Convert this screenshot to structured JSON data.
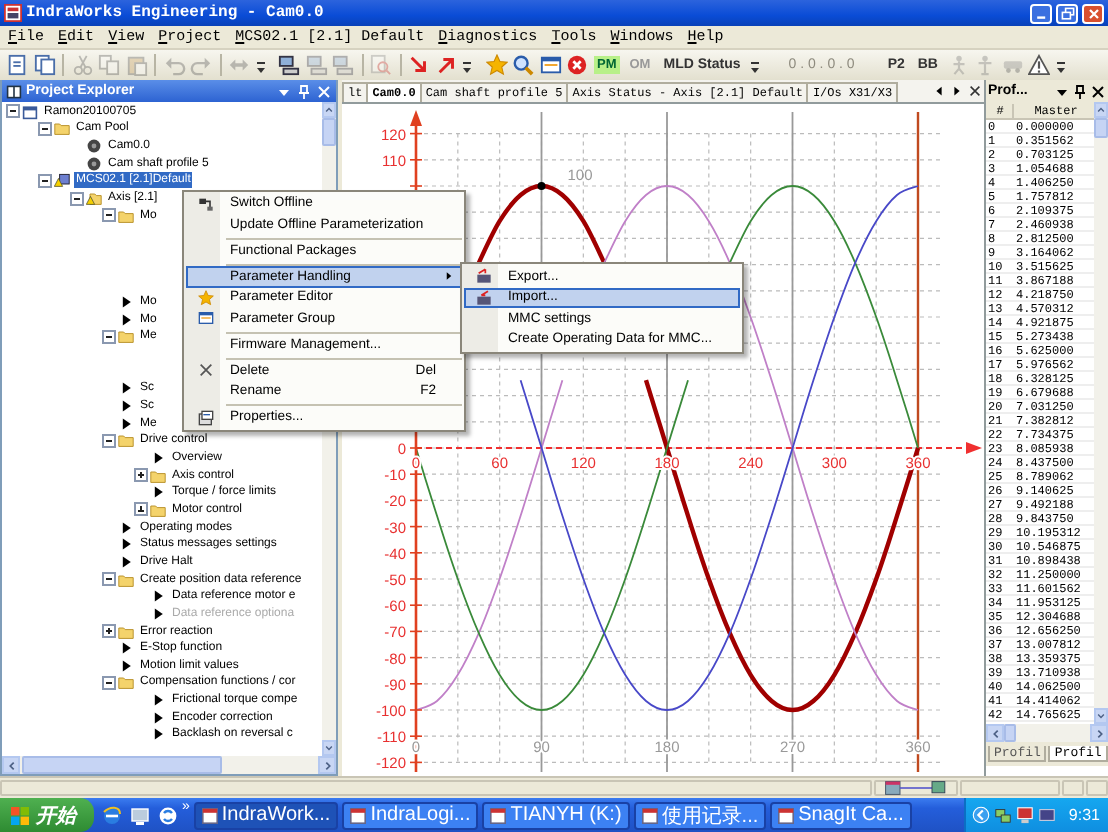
{
  "window": {
    "title": "IndraWorks Engineering - Cam0.0"
  },
  "menu_bar": [
    "File",
    "Edit",
    "View",
    "Project",
    "MCS02.1 [2.1] Default",
    "Diagnostics",
    "Tools",
    "Windows",
    "Help"
  ],
  "toolbar": [
    {
      "kind": "icon",
      "disabled": false
    },
    {
      "kind": "icon",
      "disabled": false
    },
    {
      "kind": "separator"
    },
    {
      "kind": "icon",
      "disabled": true
    },
    {
      "kind": "icon",
      "disabled": true
    },
    {
      "kind": "icon",
      "disabled": true
    },
    {
      "kind": "separator"
    },
    {
      "kind": "icon",
      "disabled": true
    },
    {
      "kind": "icon",
      "disabled": true
    },
    {
      "kind": "separator"
    },
    {
      "kind": "icon",
      "disabled": true
    },
    {
      "kind": "overflow"
    },
    {
      "kind": "icon",
      "disabled": false
    },
    {
      "kind": "icon",
      "disabled": true
    },
    {
      "kind": "icon",
      "disabled": true
    },
    {
      "kind": "separator"
    },
    {
      "kind": "icon",
      "disabled": true
    },
    {
      "kind": "separator"
    },
    {
      "kind": "icon",
      "disabled": false
    },
    {
      "kind": "icon",
      "disabled": false
    },
    {
      "kind": "overflow"
    },
    {
      "kind": "icon",
      "disabled": false
    },
    {
      "kind": "icon",
      "disabled": false
    },
    {
      "kind": "icon",
      "disabled": false
    },
    {
      "kind": "icon",
      "disabled": false
    },
    {
      "kind": "toggle",
      "label": "PM",
      "on": true
    },
    {
      "kind": "toggle",
      "label": "OM",
      "on": false
    },
    {
      "kind": "text",
      "label": "MLD Status",
      "disabled": false
    },
    {
      "kind": "overflow"
    },
    {
      "kind": "text",
      "label": "0 . 0 . 0 . 0",
      "disabled": true
    },
    {
      "kind": "text",
      "label": "P2",
      "disabled": false
    },
    {
      "kind": "text",
      "label": "BB",
      "disabled": false
    },
    {
      "kind": "icon",
      "disabled": true
    },
    {
      "kind": "icon",
      "disabled": true
    },
    {
      "kind": "icon",
      "disabled": true
    },
    {
      "kind": "icon",
      "disabled": false
    },
    {
      "kind": "overflow"
    }
  ],
  "project_explorer": {
    "title": "Project Explorer",
    "tree": [
      {
        "label": "Ramon20100705",
        "kind": "project",
        "expanded": true,
        "selected": false,
        "children": [
          {
            "label": "Cam Pool",
            "kind": "folder",
            "expanded": true,
            "selected": false,
            "children": [
              {
                "label": "Cam0.0",
                "kind": "cam",
                "selected": false
              },
              {
                "label": "Cam shaft profile 5",
                "kind": "cam",
                "selected": false
              }
            ]
          },
          {
            "label": "MCS02.1 [2.1]Default",
            "kind": "device",
            "expanded": true,
            "selected": true,
            "children": [
              {
                "label": "Axis [2.1]",
                "kind": "axis",
                "expanded": true,
                "selected": false,
                "children": [
                  {
                    "label": "Mo",
                    "kind": "folder",
                    "expanded": true,
                    "selected": false,
                    "children": [
                      {
                        "kind": "covered"
                      },
                      {
                        "kind": "covered"
                      },
                      {
                        "kind": "covered"
                      },
                      {
                        "kind": "covered"
                      }
                    ]
                  },
                  {
                    "label": "Mo",
                    "kind": "leaf",
                    "selected": false
                  },
                  {
                    "label": "Mo",
                    "kind": "leaf",
                    "selected": false
                  },
                  {
                    "label": "Me",
                    "kind": "folder",
                    "expanded": true,
                    "selected": false,
                    "children": [
                      {
                        "kind": "covered"
                      },
                      {
                        "kind": "covered"
                      }
                    ]
                  },
                  {
                    "label": "Sc",
                    "kind": "leaf",
                    "selected": false
                  },
                  {
                    "label": "Sc",
                    "kind": "leaf",
                    "selected": false
                  },
                  {
                    "label": "Me",
                    "kind": "leaf",
                    "selected": false
                  },
                  {
                    "label": "Drive control",
                    "kind": "folder",
                    "expanded": true,
                    "selected": false,
                    "children": [
                      {
                        "label": "Overview",
                        "kind": "leaf",
                        "selected": false
                      },
                      {
                        "label": "Axis control",
                        "kind": "folder",
                        "expanded": false,
                        "selected": false
                      },
                      {
                        "label": "Torque / force limits",
                        "kind": "leaf",
                        "selected": false
                      },
                      {
                        "label": "Motor control",
                        "kind": "folder",
                        "expanded": false,
                        "selected": false
                      }
                    ]
                  },
                  {
                    "label": "Operating modes",
                    "kind": "leaf",
                    "selected": false
                  },
                  {
                    "label": "Status messages settings",
                    "kind": "leaf",
                    "selected": false
                  },
                  {
                    "label": "Drive Halt",
                    "kind": "leaf",
                    "selected": false
                  },
                  {
                    "label": "Create position data reference",
                    "kind": "folder",
                    "expanded": true,
                    "selected": false,
                    "children": [
                      {
                        "label": "Data reference motor e",
                        "kind": "leaf",
                        "selected": false,
                        "disabled": false
                      },
                      {
                        "label": "Data reference optiona",
                        "kind": "leaf",
                        "selected": false,
                        "disabled": true
                      }
                    ]
                  },
                  {
                    "label": "Error reaction",
                    "kind": "folder",
                    "expanded": false,
                    "selected": false
                  },
                  {
                    "label": "E-Stop function",
                    "kind": "leaf",
                    "selected": false
                  },
                  {
                    "label": "Motion limit values",
                    "kind": "leaf",
                    "selected": false
                  },
                  {
                    "label": "Compensation functions / cor",
                    "kind": "folder",
                    "expanded": true,
                    "selected": false,
                    "children": [
                      {
                        "label": "Frictional torque compe",
                        "kind": "leaf",
                        "selected": false
                      },
                      {
                        "label": "Encoder correction",
                        "kind": "leaf",
                        "selected": false
                      },
                      {
                        "label": "Backlash on reversal c",
                        "kind": "leaf",
                        "selected": false
                      }
                    ]
                  }
                ]
              }
            ]
          }
        ]
      }
    ]
  },
  "context_menu": {
    "items": [
      {
        "kind": "item",
        "label": "Switch Offline",
        "selected": false
      },
      {
        "kind": "item",
        "label": "Update Offline Parameterization",
        "selected": false
      },
      {
        "kind": "separator"
      },
      {
        "kind": "item",
        "label": "Functional Packages",
        "selected": false
      },
      {
        "kind": "separator"
      },
      {
        "kind": "item",
        "label": "Parameter Handling",
        "selected": true,
        "submenu": true
      },
      {
        "kind": "item",
        "label": "Parameter Editor",
        "selected": false
      },
      {
        "kind": "item",
        "label": "Parameter Group",
        "selected": false
      },
      {
        "kind": "separator"
      },
      {
        "kind": "item",
        "label": "Firmware Management...",
        "selected": false
      },
      {
        "kind": "separator"
      },
      {
        "kind": "item",
        "label": "Delete",
        "shortcut": "Del",
        "selected": false
      },
      {
        "kind": "item",
        "label": "Rename",
        "shortcut": "F2",
        "selected": false
      },
      {
        "kind": "separator"
      },
      {
        "kind": "item",
        "label": "Properties...",
        "selected": false
      }
    ]
  },
  "submenu": {
    "items": [
      {
        "kind": "item",
        "label": "Export...",
        "selected": false
      },
      {
        "kind": "item",
        "label": "Import...",
        "selected": true
      },
      {
        "kind": "item",
        "label": "MMC settings",
        "selected": false
      },
      {
        "kind": "item",
        "label": "Create Operating Data for MMC...",
        "selected": false
      }
    ]
  },
  "document_tabs": [
    {
      "label": "lt",
      "selected": false
    },
    {
      "label": "Cam0.0",
      "selected": true
    },
    {
      "label": "Cam shaft profile 5",
      "selected": false
    },
    {
      "label": "Axis Status - Axis [2.1] Default",
      "selected": false
    },
    {
      "label": "I/Os X31/X3",
      "selected": false
    }
  ],
  "cam_chart": {
    "grid_labels": [
      "0",
      "90",
      "180",
      "270",
      "360"
    ],
    "chart_data": {
      "type": "line",
      "x": [
        0,
        15,
        30,
        45,
        60,
        75,
        90,
        105,
        120,
        135,
        150,
        165,
        180,
        195,
        210,
        225,
        240,
        255,
        270,
        285,
        300,
        315,
        330,
        345,
        360
      ],
      "series": [
        {
          "color": "#a00000",
          "values": [
            null,
            null,
            null,
            70.7,
            86.6,
            96.6,
            100,
            96.6,
            86.6,
            70.7,
            null,
            25.9,
            0,
            -25.9,
            -50,
            -70.7,
            -86.6,
            -96.6,
            -100,
            -96.6,
            -86.6,
            -70.7,
            -50,
            -25.9,
            0
          ]
        },
        {
          "color": "#c080c8",
          "values": [
            -100,
            -96.6,
            -86.6,
            -70.7,
            -50,
            -25.9,
            0,
            25.9,
            null,
            70.7,
            86.6,
            96.6,
            100,
            96.6,
            86.6,
            70.7,
            50,
            25.9,
            0,
            -25.9,
            -50,
            -70.7,
            -86.6,
            -96.6,
            -100
          ]
        },
        {
          "color": "#3a8a3a",
          "values": [
            0,
            -25.9,
            -50,
            -70.7,
            -86.6,
            -96.6,
            -100,
            -96.6,
            -86.6,
            -70.7,
            -50,
            -25.9,
            0,
            25.9,
            null,
            70.7,
            86.6,
            96.6,
            100,
            96.6,
            86.6,
            70.7,
            50,
            25.9,
            0
          ]
        },
        {
          "color": "#4848c8",
          "values": [
            null,
            null,
            null,
            null,
            null,
            25.9,
            0,
            -25.9,
            -50,
            -70.7,
            -86.6,
            -96.6,
            -100,
            -96.6,
            -86.6,
            -70.7,
            -50,
            -25.9,
            0,
            25.9,
            50,
            70.7,
            86.6,
            96.6,
            100
          ]
        }
      ],
      "xlim": [
        0,
        360
      ],
      "ylim": [
        -120,
        120
      ],
      "xticks": [
        0,
        60,
        120,
        180,
        240,
        300,
        360
      ],
      "yticks": [
        -120,
        -110,
        -100,
        -90,
        -80,
        -70,
        -60,
        -50,
        -40,
        -30,
        -20,
        -10,
        0,
        110,
        120
      ],
      "grid": true,
      "ref_lines": [
        {
          "axis": "x",
          "value": 360,
          "color": "#c04a20"
        },
        {
          "axis": "y",
          "value": 0,
          "color": "#f03030"
        }
      ],
      "annotations": [
        {
          "x": 90,
          "y": 100,
          "text": "100"
        }
      ]
    }
  },
  "profile_panel": {
    "title": "Prof...",
    "columns": [
      "#",
      "Master"
    ],
    "rows": [
      [
        "0",
        "0.000000"
      ],
      [
        "1",
        "0.351562"
      ],
      [
        "2",
        "0.703125"
      ],
      [
        "3",
        "1.054688"
      ],
      [
        "4",
        "1.406250"
      ],
      [
        "5",
        "1.757812"
      ],
      [
        "6",
        "2.109375"
      ],
      [
        "7",
        "2.460938"
      ],
      [
        "8",
        "2.812500"
      ],
      [
        "9",
        "3.164062"
      ],
      [
        "10",
        "3.515625"
      ],
      [
        "11",
        "3.867188"
      ],
      [
        "12",
        "4.218750"
      ],
      [
        "13",
        "4.570312"
      ],
      [
        "14",
        "4.921875"
      ],
      [
        "15",
        "5.273438"
      ],
      [
        "16",
        "5.625000"
      ],
      [
        "17",
        "5.976562"
      ],
      [
        "18",
        "6.328125"
      ],
      [
        "19",
        "6.679688"
      ],
      [
        "20",
        "7.031250"
      ],
      [
        "21",
        "7.382812"
      ],
      [
        "22",
        "7.734375"
      ],
      [
        "23",
        "8.085938"
      ],
      [
        "24",
        "8.437500"
      ],
      [
        "25",
        "8.789062"
      ],
      [
        "26",
        "9.140625"
      ],
      [
        "27",
        "9.492188"
      ],
      [
        "28",
        "9.843750"
      ],
      [
        "29",
        "10.195312"
      ],
      [
        "30",
        "10.546875"
      ],
      [
        "31",
        "10.898438"
      ],
      [
        "32",
        "11.250000"
      ],
      [
        "33",
        "11.601562"
      ],
      [
        "34",
        "11.953125"
      ],
      [
        "35",
        "12.304688"
      ],
      [
        "36",
        "12.656250"
      ],
      [
        "37",
        "13.007812"
      ],
      [
        "38",
        "13.359375"
      ],
      [
        "39",
        "13.710938"
      ],
      [
        "40",
        "14.062500"
      ],
      [
        "41",
        "14.414062"
      ],
      [
        "42",
        "14.765625"
      ]
    ],
    "tabs": [
      {
        "label": "Profil",
        "selected": false
      },
      {
        "label": "Profil",
        "selected": true
      }
    ]
  },
  "taskbar": {
    "start": "开始",
    "more": "»",
    "tasks": [
      {
        "label": "IndraWork...",
        "selected": true
      },
      {
        "label": "IndraLogi...",
        "selected": false
      },
      {
        "label": "TIANYH (K:)",
        "selected": false
      },
      {
        "label": "使用记录...",
        "selected": false
      },
      {
        "label": "SnagIt Ca...",
        "selected": false
      }
    ],
    "clock": "9:31"
  }
}
